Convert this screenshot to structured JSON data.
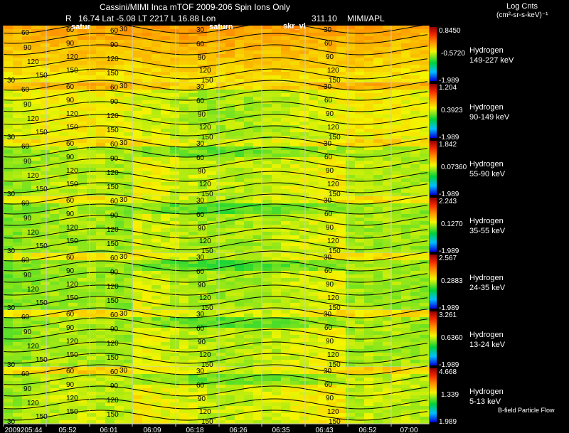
{
  "header": {
    "title": "Cassini/MIMI Inca mTOF  2009-206   Spin    Ions Only",
    "r_label": "R",
    "info": "16.74 Lat -5.08 LT 2217 L          16.88 Lon",
    "lon_value": "311.10",
    "org": "MIMI/APL",
    "units_line1": "Log Cnts",
    "units_line2": "(cm²-sr-s-keV)⁻¹"
  },
  "bfield_label": "B-field Particle Flow",
  "colors": {
    "background": "#000000",
    "grid": "#cccccc",
    "contour": "#000000",
    "annotation_text": "#ffffff"
  },
  "chart_data": {
    "type": "heatmap",
    "x_tick_labels": [
      "2009205:44",
      "05:52",
      "06:01",
      "06:09",
      "06:18",
      "06:26",
      "06:35",
      "06:43",
      "06:52",
      "07:00"
    ],
    "annotations": [
      "satur",
      "saturn",
      "skr_vl"
    ],
    "contour_labels_left": [
      "60",
      "90",
      "120",
      "150",
      "30"
    ],
    "contour_labels_col2": [
      "60",
      "90",
      "120",
      "150"
    ],
    "contour_labels_col3": [
      "30",
      "60",
      "90",
      "120",
      "150"
    ],
    "contour_labels_mid": [
      "30",
      "60",
      "90",
      "120",
      "150"
    ],
    "contour_labels_right": [
      "30",
      "60",
      "90",
      "120",
      "150"
    ],
    "panels": [
      {
        "species": "Hydrogen",
        "energy": "149-227 keV",
        "max": "0.8450",
        "mid": "-0.5720",
        "min": "-1.989",
        "level": 0.7
      },
      {
        "species": "Hydrogen",
        "energy": "90-149 keV",
        "max": "1.204",
        "mid": "0.3923",
        "min": "-1.989",
        "level": 0.52
      },
      {
        "species": "Hydrogen",
        "energy": "55-90 keV",
        "max": "1.842",
        "mid": "0.07360",
        "min": "-1.989",
        "level": 0.46
      },
      {
        "species": "Hydrogen",
        "energy": "35-55 keV",
        "max": "2.243",
        "mid": "0.1270",
        "min": "-1.989",
        "level": 0.44
      },
      {
        "species": "Hydrogen",
        "energy": "24-35 keV",
        "max": "2.567",
        "mid": "0.2883",
        "min": "-1.989",
        "level": 0.44
      },
      {
        "species": "Hydrogen",
        "energy": "13-24 keV",
        "max": "3.261",
        "mid": "0.6360",
        "min": "-1.989",
        "level": 0.45
      },
      {
        "species": "Hydrogen",
        "energy": "5-13 keV",
        "max": "4.668",
        "mid": "1.339",
        "min": "1.989",
        "level": 0.47
      }
    ]
  }
}
